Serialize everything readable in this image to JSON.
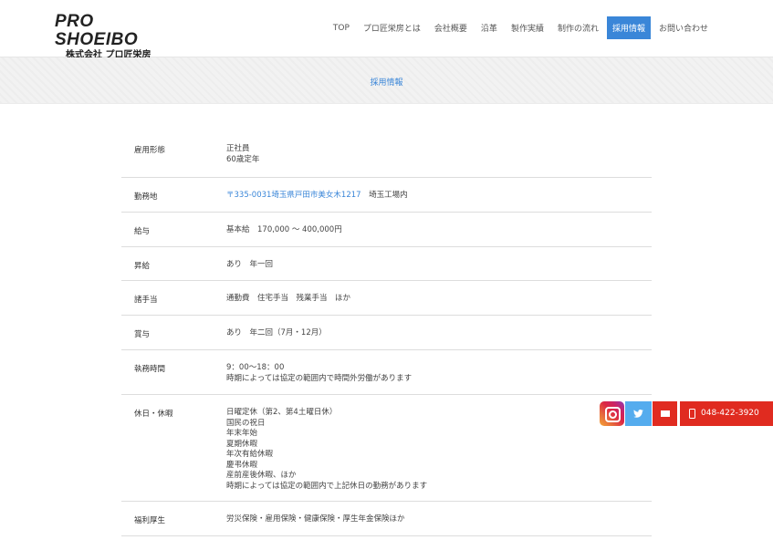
{
  "header": {
    "logo_main": "PRO SHOEIBO",
    "logo_sub": "株式会社 プロ匠栄房",
    "nav": [
      {
        "label": "TOP"
      },
      {
        "label": "プロ匠栄房とは"
      },
      {
        "label": "会社概要"
      },
      {
        "label": "沿革"
      },
      {
        "label": "製作実績"
      },
      {
        "label": "制作の流れ"
      },
      {
        "label": "採用情報",
        "active": true
      },
      {
        "label": "お問い合わせ"
      }
    ],
    "accent_color": "#3a86d8"
  },
  "banner": {
    "title": "採用情報"
  },
  "table": {
    "rows": [
      {
        "label": "雇用形態",
        "lines": [
          "正社員",
          "60歳定年"
        ]
      },
      {
        "label": "勤務地",
        "link": "〒335-0031埼玉県戸田市美女木1217",
        "after": "　埼玉工場内"
      },
      {
        "label": "給与",
        "lines": [
          "基本給　170,000 ～ 400,000円"
        ]
      },
      {
        "label": "昇給",
        "lines": [
          "あり　年一回"
        ]
      },
      {
        "label": "諸手当",
        "lines": [
          "通勤費　住宅手当　残業手当　ほか"
        ]
      },
      {
        "label": "賞与",
        "lines": [
          "あり　年二回（7月・12月）"
        ]
      },
      {
        "label": "執務時間",
        "lines": [
          "9：00～18：00",
          "時期によっては協定の範囲内で時間外労働があります"
        ]
      },
      {
        "label": "休日・休暇",
        "lines": [
          "日曜定休（第2、第4土曜日休）",
          "国民の祝日",
          "年末年始",
          "夏期休暇",
          "年次有給休暇",
          "慶弔休暇",
          "産前産後休暇、ほか",
          "時期によっては協定の範囲内で上記休日の勤務があります"
        ]
      },
      {
        "label": "福利厚生",
        "lines": [
          "労災保険・雇用保険・健康保険・厚生年金保険ほか"
        ]
      }
    ]
  },
  "contact": {
    "phone": "048-422-3920",
    "twitter_icon": "twitter-icon",
    "insta_icon": "instagram-icon",
    "mail_icon": "mail-icon",
    "phone_icon": "phone-icon",
    "mail_color": "#e02b20",
    "twitter_color": "#55acee"
  }
}
